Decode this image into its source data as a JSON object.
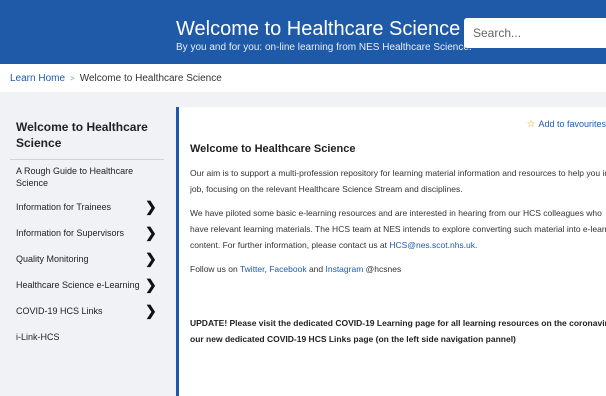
{
  "header": {
    "title": "Welcome to Healthcare Science",
    "subtitle": "By you and for you: on-line learning from NES Healthcare Science.",
    "search_placeholder": "Search..."
  },
  "breadcrumb": {
    "home": "Learn Home",
    "separator": ">",
    "current": "Welcome to Healthcare Science"
  },
  "sidebar": {
    "title": "Welcome to Healthcare Science",
    "items": [
      {
        "label": "A Rough Guide to Healthcare Science",
        "chevron": ""
      },
      {
        "label": "Information for Trainees",
        "chevron": "❯"
      },
      {
        "label": "Information for Supervisors",
        "chevron": "❯"
      },
      {
        "label": "Quality Monitoring",
        "chevron": "❯"
      },
      {
        "label": "Healthcare Science e-Learning",
        "chevron": "❯"
      },
      {
        "label": "COVID-19 HCS Links",
        "chevron": "❯"
      },
      {
        "label": "i-Link-HCS",
        "chevron": ""
      }
    ]
  },
  "content": {
    "favourites": "Add to favourites",
    "title": "Welcome to Healthcare Science",
    "p1_line1": "Our aim is to support a multi-profession repository for learning material information and resources to help you in your",
    "p1_line2": "job, focusing on the relevant Healthcare Science Stream and disciplines.",
    "p2_line1": "We have piloted some basic e-learning resources and are interested in hearing from our HCS colleagues who",
    "p2_line2": "have relevant learning materials. The HCS team at NES intends to explore converting such material into e-learning",
    "p2_line3_a": "content. For further information, please contact us at ",
    "p2_email": "HCS@nes.scot.nhs.uk",
    "p2_line3_b": ".",
    "follow_a": "Follow us on ",
    "twitter": "Twitter",
    "comma": ", ",
    "facebook": "Facebook",
    "and": " and ",
    "instagram": "Instagram",
    "handle": " @hcsnes",
    "update_line1": "UPDATE! Please visit the dedicated COVID-19 Learning page for all learning resources on the coronavirus and",
    "update_line2": "our new dedicated COVID-19 HCS Links page (on the left side navigation pannel)"
  }
}
